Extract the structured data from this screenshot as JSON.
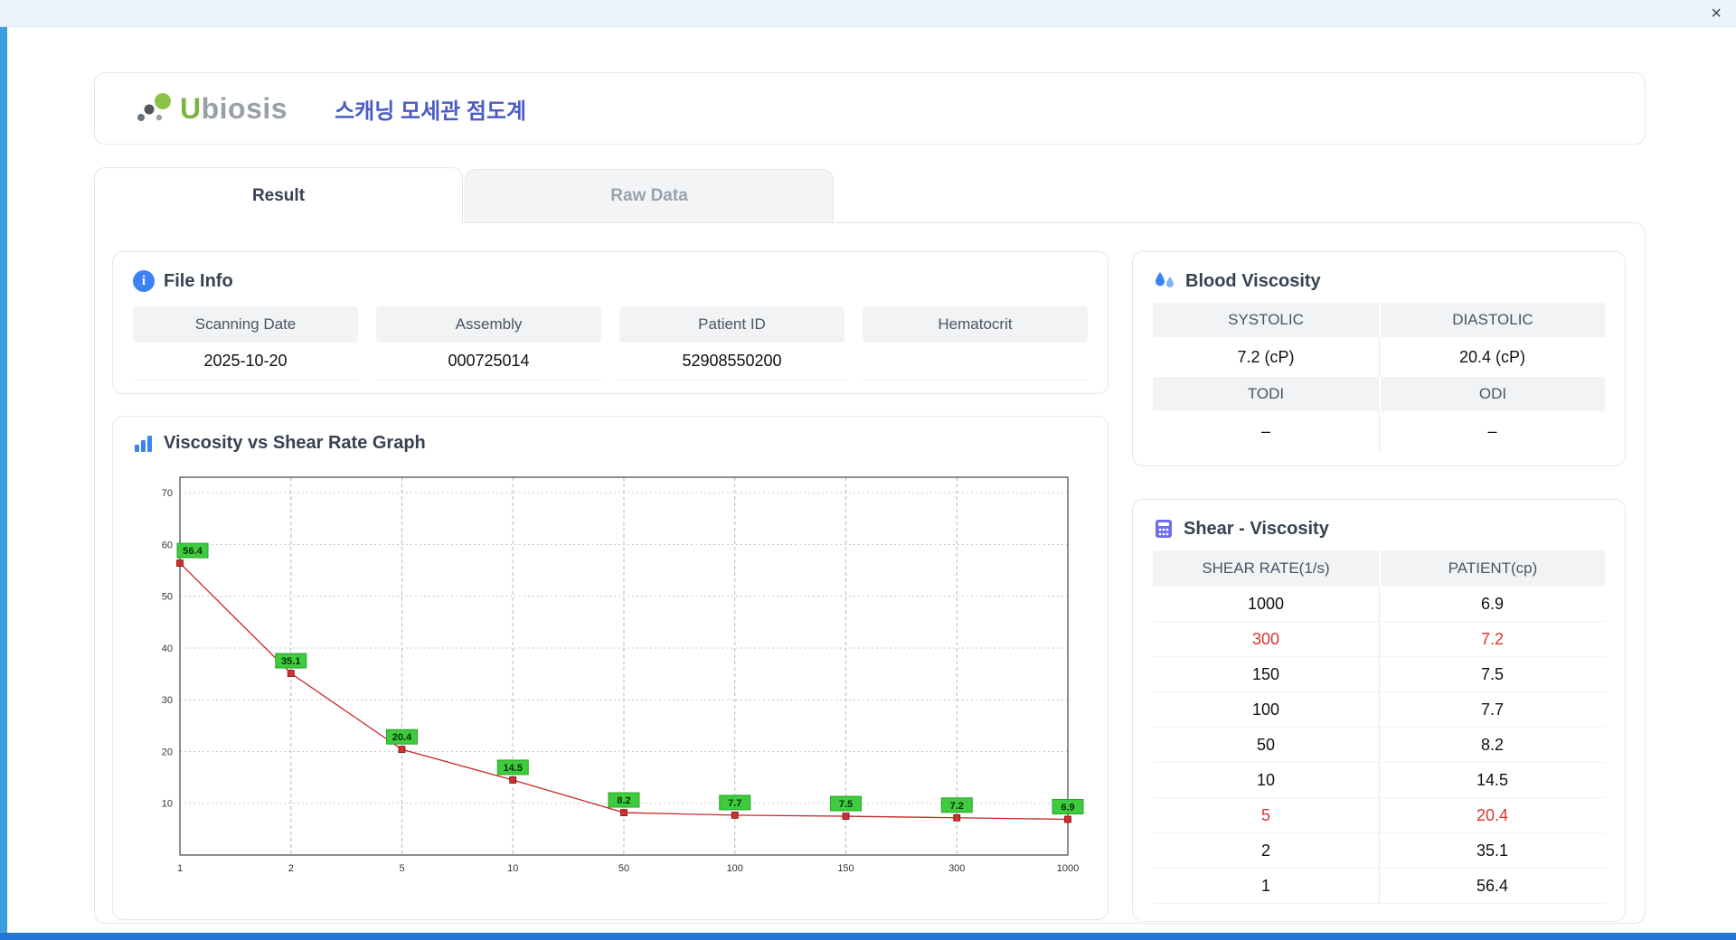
{
  "window": {
    "close_glyph": "×"
  },
  "header": {
    "logo_text": "Ubiosis",
    "title": "스캐닝 모세관 점도계"
  },
  "tabs": {
    "result": "Result",
    "raw_data": "Raw Data"
  },
  "file_info": {
    "title": "File Info",
    "fields": [
      {
        "label": "Scanning Date",
        "value": "2025-10-20"
      },
      {
        "label": "Assembly",
        "value": "000725014"
      },
      {
        "label": "Patient ID",
        "value": "52908550200"
      },
      {
        "label": "Hematocrit",
        "value": ""
      }
    ]
  },
  "graph": {
    "title": "Viscosity vs Shear Rate Graph"
  },
  "chart_data": {
    "type": "line",
    "title": "Viscosity vs Shear Rate Graph",
    "x": [
      1,
      2,
      5,
      10,
      50,
      100,
      150,
      300,
      1000
    ],
    "x_ticks": [
      "1",
      "2",
      "5",
      "10",
      "50",
      "100",
      "150",
      "300",
      "1000"
    ],
    "values": [
      56.4,
      35.1,
      20.4,
      14.5,
      8.2,
      7.7,
      7.5,
      7.2,
      6.9
    ],
    "y_ticks": [
      10,
      20,
      30,
      40,
      50,
      60,
      70
    ],
    "ylim": [
      0,
      73
    ],
    "x_scale": "category",
    "grid": true,
    "line_color": "#c62828",
    "marker_color": "#d32f2f",
    "label_bg": "#3ecb3e",
    "label_border": "#28a428"
  },
  "blood_viscosity": {
    "title": "Blood Viscosity",
    "cells": [
      {
        "label": "SYSTOLIC",
        "value": "7.2 (cP)"
      },
      {
        "label": "DIASTOLIC",
        "value": "20.4 (cP)"
      },
      {
        "label": "TODI",
        "value": "–"
      },
      {
        "label": "ODI",
        "value": "–"
      }
    ]
  },
  "shear_viscosity": {
    "title": "Shear - Viscosity",
    "columns": [
      "SHEAR RATE(1/s)",
      "PATIENT(cp)"
    ],
    "rows": [
      {
        "shear": "1000",
        "patient": "6.9",
        "highlight": false
      },
      {
        "shear": "300",
        "patient": "7.2",
        "highlight": true
      },
      {
        "shear": "150",
        "patient": "7.5",
        "highlight": false
      },
      {
        "shear": "100",
        "patient": "7.7",
        "highlight": false
      },
      {
        "shear": "50",
        "patient": "8.2",
        "highlight": false
      },
      {
        "shear": "10",
        "patient": "14.5",
        "highlight": false
      },
      {
        "shear": "5",
        "patient": "20.4",
        "highlight": true
      },
      {
        "shear": "2",
        "patient": "35.1",
        "highlight": false
      },
      {
        "shear": "1",
        "patient": "56.4",
        "highlight": false
      }
    ]
  },
  "colors": {
    "window_blue": "#3aa0dc",
    "window_blue_dark": "#2377d9",
    "title_blue": "#4a5cc5",
    "accent_blue": "#3b82f6",
    "highlight_red": "#d9342f",
    "logo_green": "#7cb342",
    "calc_purple": "#6c6cf0"
  }
}
